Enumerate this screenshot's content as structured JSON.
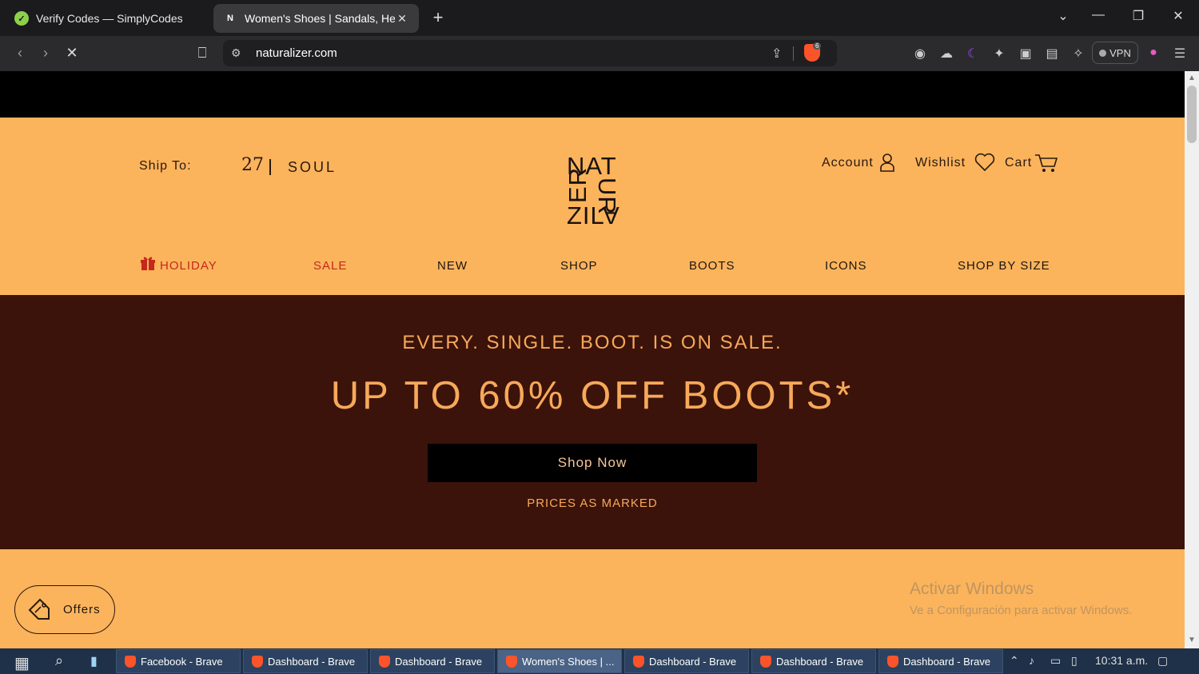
{
  "browser": {
    "tabs": [
      {
        "title": "Verify Codes — SimplyCodes",
        "active": false
      },
      {
        "title": "Women's Shoes | Sandals, Heels",
        "active": true
      }
    ],
    "new_tab_symbol": "+",
    "url": "naturalizer.com",
    "brave_shield_count": "6",
    "vpn_label": "VPN"
  },
  "site": {
    "ship_to_label": "Ship To:",
    "ship_to_logo": "27",
    "ship_to_brand": "SOUL",
    "logo_letters": {
      "row1": "NAT",
      "left_col": "ER",
      "right_col": "UR",
      "row3": "ZIL",
      "row3b": "A"
    },
    "header_links": {
      "account": "Account",
      "wishlist": "Wishlist",
      "cart": "Cart"
    },
    "nav": [
      {
        "label": "HOLIDAY",
        "color": "#c4281c"
      },
      {
        "label": "SALE",
        "color": "#c4281c"
      },
      {
        "label": "NEW",
        "color": "#1f1410"
      },
      {
        "label": "SHOP",
        "color": "#1f1410"
      },
      {
        "label": "BOOTS",
        "color": "#1f1410"
      },
      {
        "label": "ICONS",
        "color": "#1f1410"
      },
      {
        "label": "SHOP BY SIZE",
        "color": "#1f1410"
      }
    ],
    "hero": {
      "subheading": "EVERY. SINGLE. BOOT. IS ON SALE.",
      "heading": "UP TO 60% OFF BOOTS*",
      "cta": "Shop Now",
      "note": "PRICES AS MARKED"
    },
    "offers_label": "Offers"
  },
  "watermark": {
    "line1": "Activar Windows",
    "line2": "Ve a Configuración para activar Windows."
  },
  "taskbar": {
    "tasks": [
      {
        "label": "Facebook - Brave",
        "active": false
      },
      {
        "label": "Dashboard - Brave",
        "active": false
      },
      {
        "label": "Dashboard - Brave",
        "active": false
      },
      {
        "label": "Women's Shoes | ...",
        "active": true
      },
      {
        "label": "Dashboard - Brave",
        "active": false
      },
      {
        "label": "Dashboard - Brave",
        "active": false
      },
      {
        "label": "Dashboard - Brave",
        "active": false
      }
    ],
    "clock": "10:31 a.m."
  },
  "colors": {
    "page_bg": "#fbb45c",
    "hero_bg": "#3b130a",
    "hero_text": "#f7a95a",
    "accent_red": "#c4281c"
  }
}
